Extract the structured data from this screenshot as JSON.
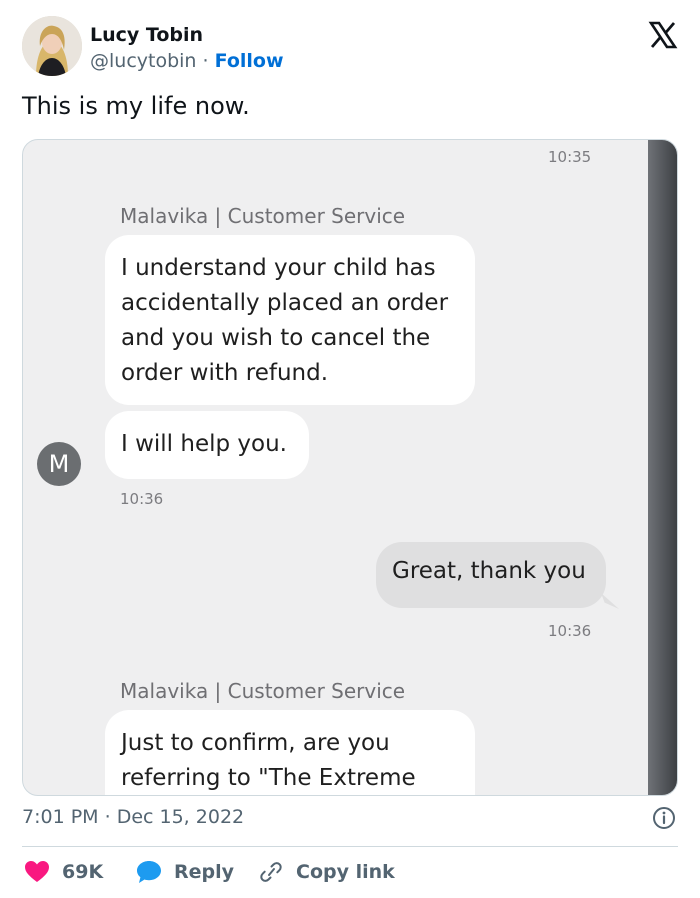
{
  "author": {
    "name": "Lucy Tobin",
    "handle": "@lucytobin",
    "separator": "·",
    "follow_label": "Follow"
  },
  "tweet": {
    "text": "This is my life now."
  },
  "chat": {
    "messages": [
      {
        "time": "10:35",
        "sender": "Malavika | Customer Service",
        "lines": [
          "I understand your child has",
          "accidentally placed an order",
          "and you wish to cancel the",
          "order with refund."
        ]
      },
      {
        "text": "I will help you.",
        "avatar_letter": "M",
        "time": "10:36"
      },
      {
        "outgoing": "Great, thank you",
        "time": "10:36"
      },
      {
        "sender": "Malavika | Customer Service",
        "lines": [
          "Just to confirm, are you",
          "referring to \"The Extreme"
        ]
      }
    ]
  },
  "meta": {
    "time": "7:01 PM",
    "separator": "·",
    "date": "Dec 15, 2022"
  },
  "actions": {
    "likes": "69K",
    "reply": "Reply",
    "copy_link": "Copy link"
  },
  "colors": {
    "follow": "#006fd6",
    "like": "#f91880",
    "reply": "#1d9bf0",
    "muted": "#536471"
  },
  "icons": [
    "x-logo-icon",
    "heart-icon",
    "reply-bubble-icon",
    "link-icon",
    "info-icon",
    "scrollbar"
  ]
}
